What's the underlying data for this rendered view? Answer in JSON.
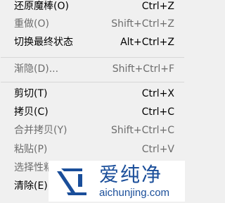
{
  "menu": {
    "items": [
      {
        "label": "还原魔棒(O)",
        "shortcut": "Ctrl+Z",
        "disabled": false
      },
      {
        "label": "重做(O)",
        "shortcut": "Shift+Ctrl+Z",
        "disabled": true
      },
      {
        "label": "切换最终状态",
        "shortcut": "Alt+Ctrl+Z",
        "disabled": false
      },
      {
        "label": "渐隐(D)...",
        "shortcut": "Shift+Ctrl+F",
        "disabled": true
      },
      {
        "label": "剪切(T)",
        "shortcut": "Ctrl+X",
        "disabled": false
      },
      {
        "label": "拷贝(C)",
        "shortcut": "Ctrl+C",
        "disabled": false
      },
      {
        "label": "合并拷贝(Y)",
        "shortcut": "Shift+Ctrl+C",
        "disabled": true
      },
      {
        "label": "粘贴(P)",
        "shortcut": "Ctrl+V",
        "disabled": true
      },
      {
        "label": "选择性粘",
        "shortcut": "",
        "disabled": true
      },
      {
        "label": "清除(E)",
        "shortcut": "",
        "disabled": false
      }
    ]
  },
  "watermark": {
    "brand_cn": "爱纯净",
    "url": "aichunjing.com",
    "color": "#1a4e9a",
    "icon": "aichunjing-logo-icon"
  }
}
